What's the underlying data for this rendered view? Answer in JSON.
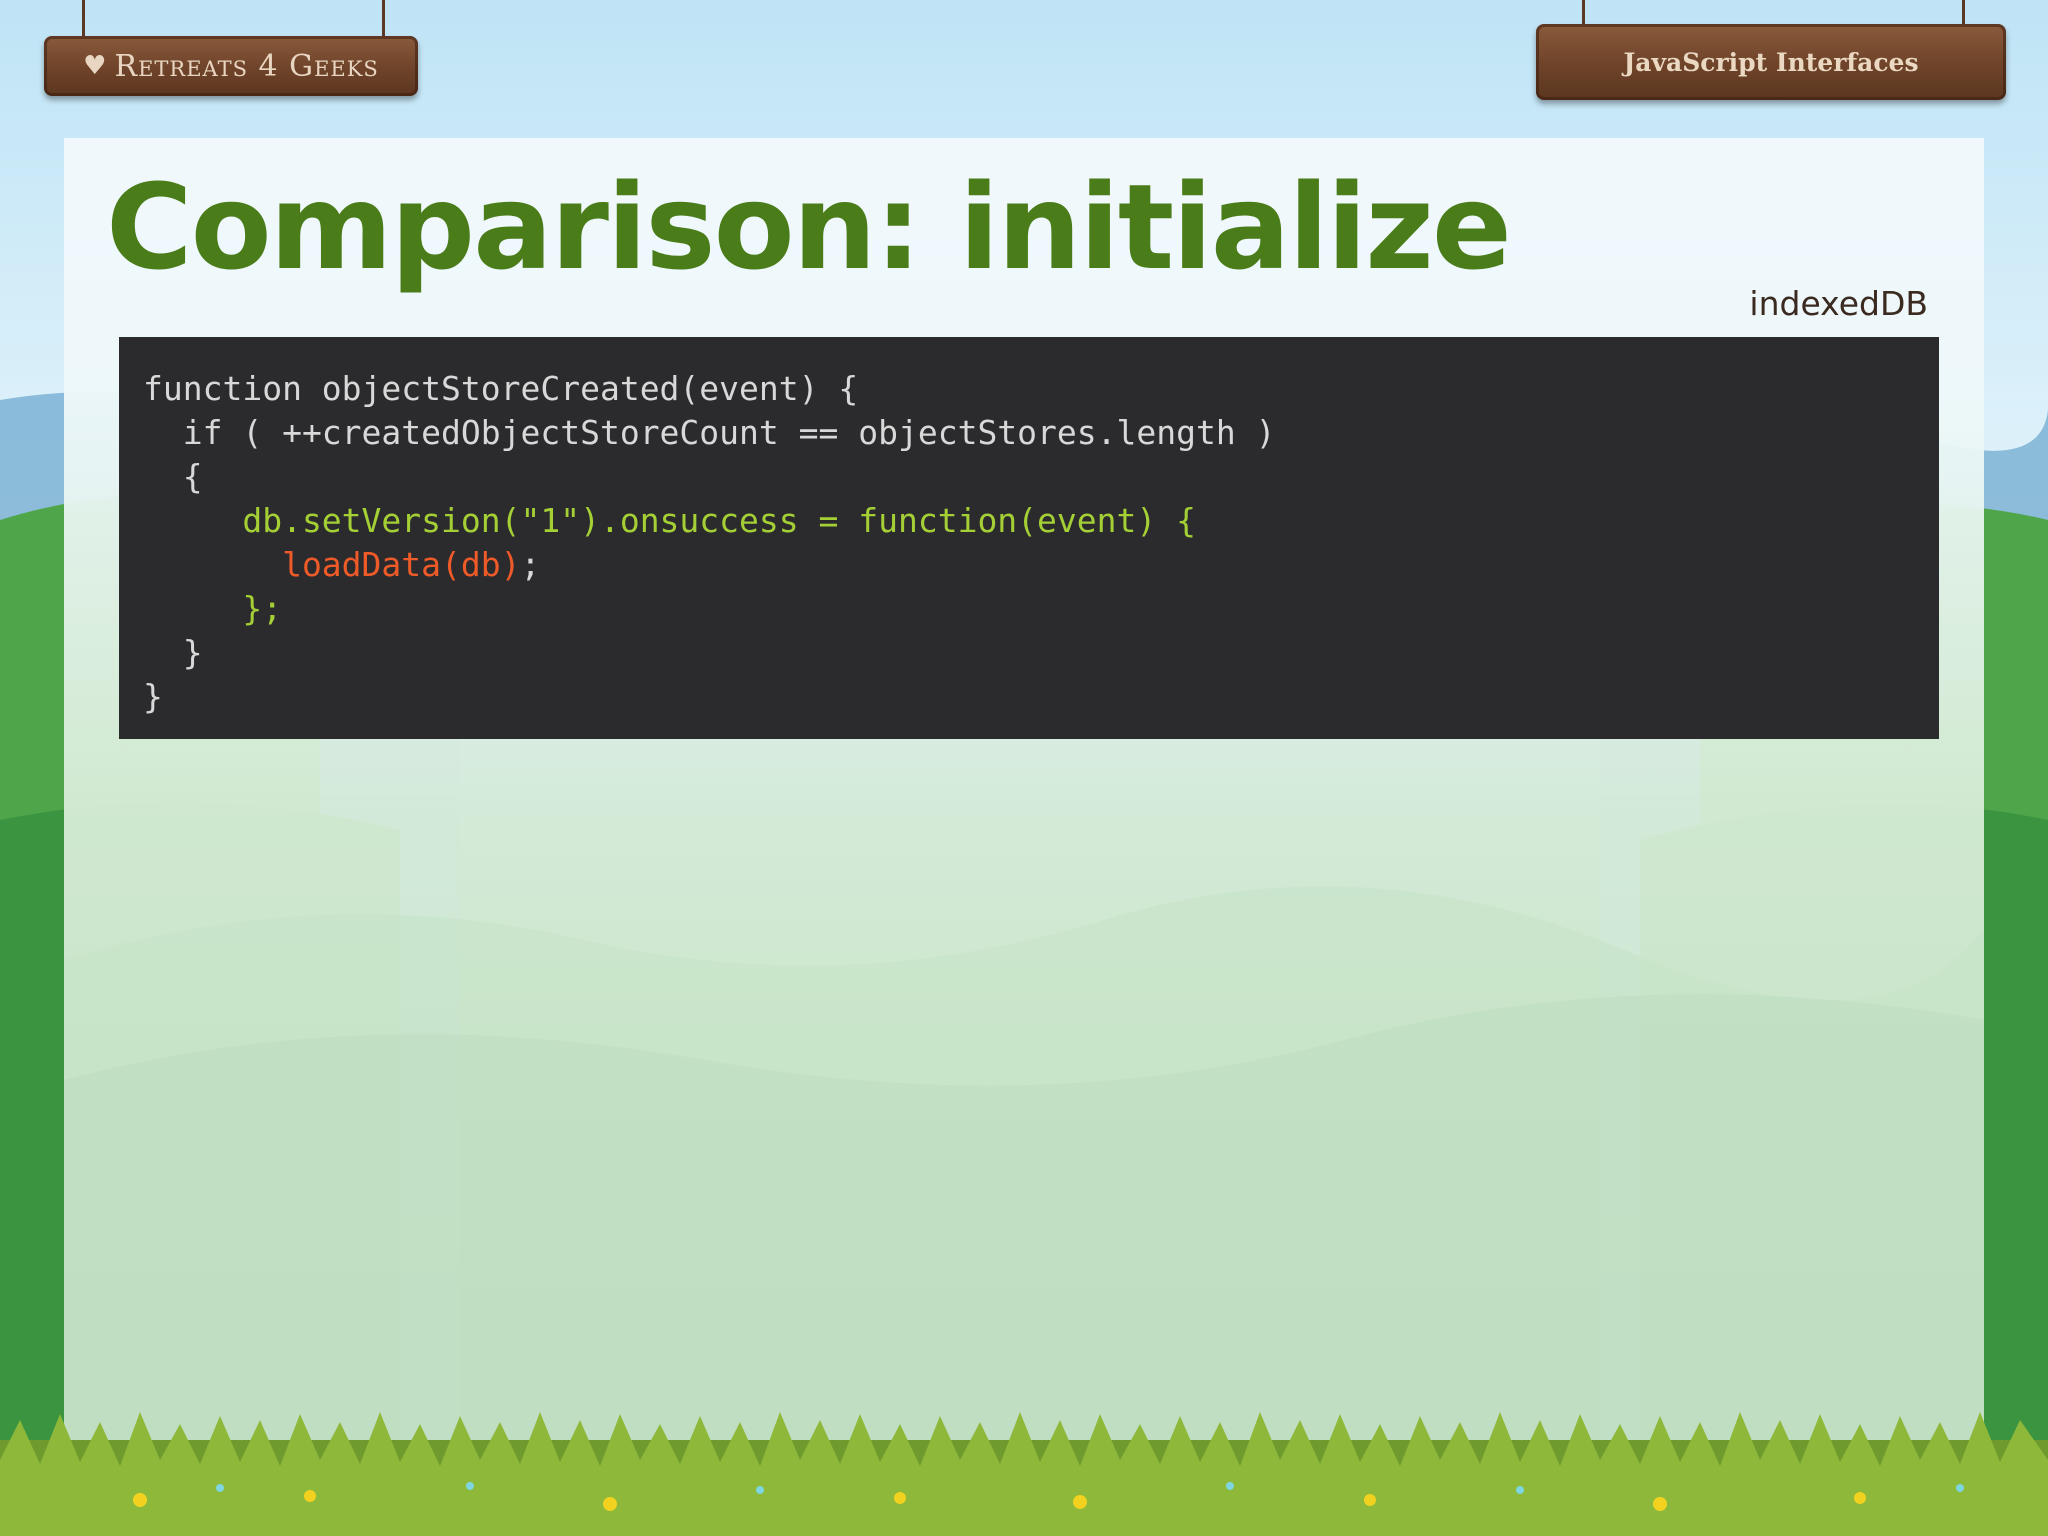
{
  "header": {
    "logo_text": "Retreats 4 Geeks",
    "deck_title": "JavaScript Interfaces"
  },
  "slide": {
    "title": "Comparison: initialize",
    "tag": "indexedDB"
  },
  "code": {
    "lines": [
      "function objectStoreCreated(event) {",
      "  if ( ++createdObjectStoreCount == objectStores.length )",
      "  {",
      "     db.setVersion(\"1\").onsuccess = function(event) {",
      "       loadData(db)",
      ";",
      "     };",
      "  }",
      "}"
    ],
    "colors": {
      "default": "#d8d8d8",
      "highlight_green": "#a4cf35",
      "highlight_orange": "#ee5a28",
      "background": "#2b2b2e"
    }
  },
  "theme": {
    "title_color": "#4a7d19",
    "sign_color": "#6e4329"
  }
}
